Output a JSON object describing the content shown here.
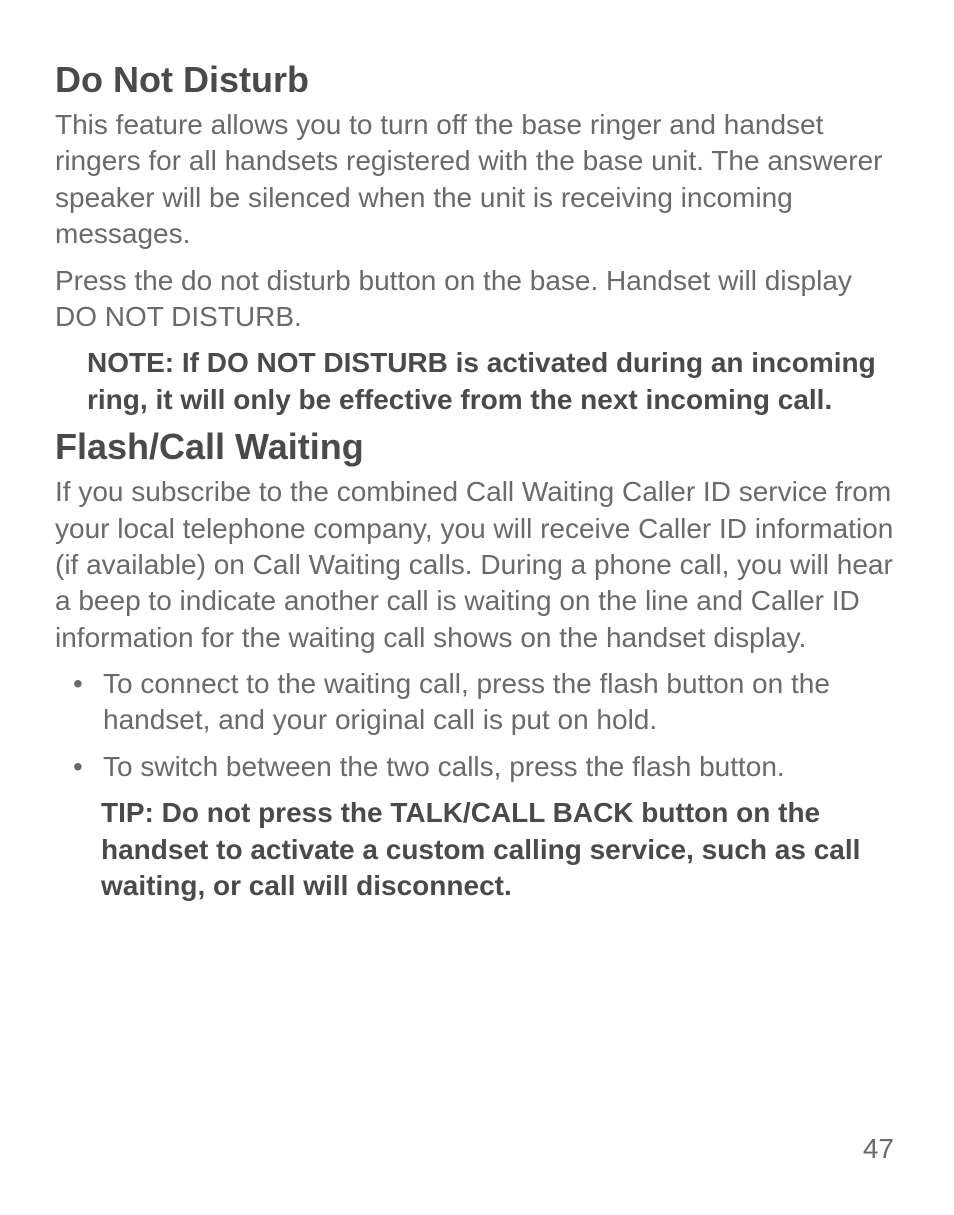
{
  "section1": {
    "heading": "Do Not Disturb",
    "para1": "This feature allows you to turn off the base ringer and handset ringers for all handsets registered with the base unit. The answerer speaker will be silenced when the unit is receiving incoming messages.",
    "para2": "Press the do not disturb button on the base. Handset will display DO NOT DISTURB.",
    "note": "NOTE: If DO NOT DISTURB is activated during an incoming ring, it will only be effective from the next incoming call."
  },
  "section2": {
    "heading": "Flash/Call Waiting",
    "para1": "If you subscribe to the combined Call Waiting Caller ID service from your local telephone company, you will receive Caller ID information (if available) on Call Waiting calls. During a phone call, you will hear a beep to indicate another call is waiting on the line and Caller ID information for the waiting call shows on the handset display.",
    "bullets": [
      "To connect to the waiting call, press the flash button on the handset, and your original call is put on hold.",
      "To switch between the two calls, press the flash button."
    ],
    "tip": "TIP: Do not press the TALK/CALL BACK button on the handset to activate a custom calling service, such as call waiting, or call will disconnect."
  },
  "pageNumber": "47"
}
